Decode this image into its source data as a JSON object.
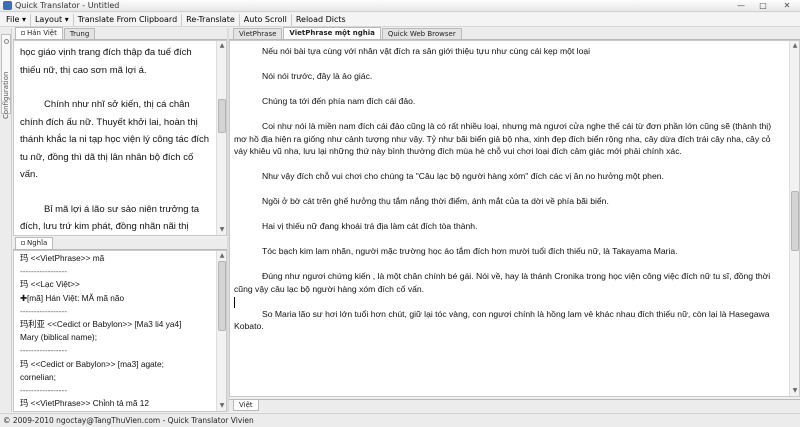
{
  "window": {
    "title": "Quick Translator - Untitled",
    "minimize_glyph": "—",
    "maximize_glyph": "□",
    "close_glyph": "✕"
  },
  "menu": {
    "items": [
      "File",
      "Layout",
      "Translate From Clipboard",
      "Re-Translate",
      "Auto Scroll",
      "Reload Dicts"
    ],
    "dropdown_marker": "▾"
  },
  "sidebar": {
    "config_label": "Configuration"
  },
  "source_panel": {
    "tabs": [
      "Hán Việt",
      "Trung"
    ],
    "paragraphs": [
      "học giáo vịnh trang đích thập đa tuế đích thiếu nữ, thị cao sơn mã lợi á.",
      "Chính như nhĩ sở kiến, thị cá chân chính đích ấu nữ. Thuyết khởi lai, hoàn thị thánh khắc la ni tạp học viện lý công tác đích tu nữ, đồng thì dã thị lân nhân bộ đích cố vấn.",
      "Bỉ mã lợi á lão sư sảo niên trưởng ta đích, lưu trứ kim phát, đồng nhãn nãi thị hồng lam dị sắc đích thiếu nữ, tắc thị vũ lại xuyên tiểu"
    ]
  },
  "dictionary_panel": {
    "tab": "Nghĩa",
    "lines": [
      "玛 <<VietPhrase>> mã",
      "-----------------",
      "玛 <<Lạc Việt>>",
      "✚[mã] Hán Việt: MÃ mã não",
      "-----------------",
      "玛利亚 <<Cedict or Babylon>>  [Ma3 li4 ya4]",
      "Mary (biblical name);",
      "-----------------",
      "玛 <<Cedict or Babylon>>  [ma3] agate;",
      "cornelian;",
      "-----------------",
      "玛 <<VietPhrase>> Chỉnh tả mã 12"
    ]
  },
  "translation_panel": {
    "tabs": [
      "VietPhrase",
      "VietPhrase một nghĩa",
      "Quick Web Browser"
    ],
    "active_tab": "VietPhrase một nghĩa",
    "bottom_tab": "Việt",
    "paragraphs": [
      "Nếu nói bài tựa cùng với nhân vật đích ra sân giới thiệu tựu như cùng cái kẹp một loại",
      "Nói nói trước, đây là ảo giác.",
      "Chúng ta tới đến phía nam đích cái đảo.",
      "Coi như nói là miền nam đích cái đảo cũng là có rất nhiều loại, nhưng mà ngươi cửa nghe thế cái từ đơn phần lớn cũng sẽ (thành thị) mơ hồ địa hiện ra giống như cảnh tượng như vậy. Tỷ như bãi biển giả bộ nha, xinh đẹp đích biển rộng nha, cây dừa đích trái cây nha, cây cỏ váy khiêu vũ nha, lưu lại những thứ này bình thường đích mùa hè chỗ vui chơi loại đích cảm giác mới phải chính xác.",
      "Như vậy đích chỗ vui chơi cho chúng ta \"Câu lạc bộ người hàng xóm\" đích các vị ăn no hưởng một phen.",
      "Ngồi ở bờ cát trên ghế hưởng thụ tắm nắng thời điểm, ánh mắt của ta dời về phía bãi biển.",
      "Hai vị thiếu nữ đang khoái trá địa làm cát đích tòa thành.",
      "Tóc bạch kim lam nhãn, người mặc trường học áo tắm đích hơn mười tuổi đích thiếu nữ, là Takayama Maria.",
      "Đúng như ngươi chứng kiến , là một chân chính bé gái. Nói về, hay là thánh Cronika trong học viện công việc đích nữ tu sĩ, đồng thời cũng vậy câu lạc bộ người hàng xóm đích cố vấn.",
      "So Maria lão sư hơi lớn tuổi hơn chút, giữ lại tóc vàng, con ngươi chính là hồng lam vẻ khác nhau đích thiếu nữ, còn lại là Hasegawa Kobato."
    ]
  },
  "statusbar": {
    "text": "© 2009-2010 ngoctay@TangThuVien.com - Quick Translator Vivien"
  },
  "colors": {
    "background": "#f0f0f0",
    "pane": "#ffffff",
    "border": "#b9b9b9",
    "app_icon": "#3a6fb5"
  }
}
